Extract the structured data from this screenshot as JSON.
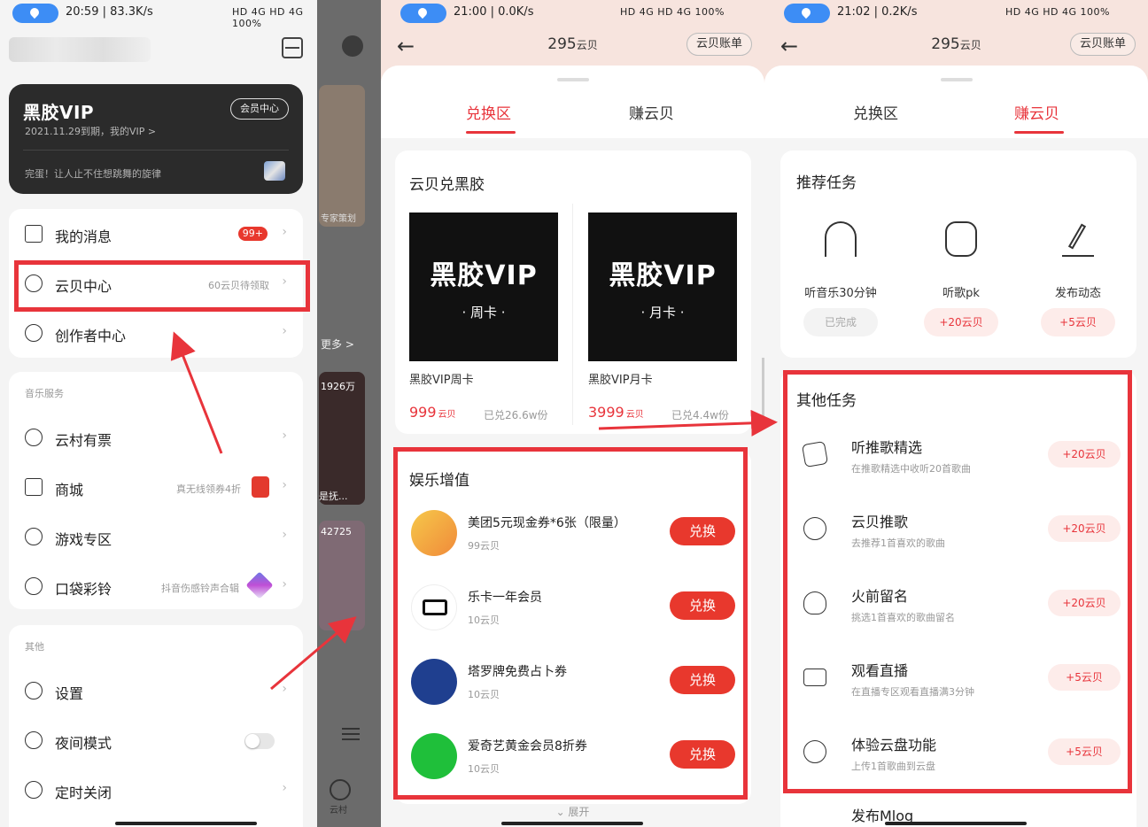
{
  "panel1": {
    "status": {
      "time": "20:59 | 83.3K/s",
      "right": "HD 4G HD 4G 100%"
    },
    "vip_card": {
      "logo": "黑胶VIP",
      "expiry": "2021.11.29到期，我的VIP >",
      "center_button": "会员中心",
      "slogan": "完蛋！让人止不住想跳舞的旋律"
    },
    "menu_main": [
      {
        "label": "我的消息",
        "badge": "99+",
        "sub": ""
      },
      {
        "label": "云贝中心",
        "badge": "",
        "sub": "60云贝待领取"
      },
      {
        "label": "创作者中心",
        "badge": "",
        "sub": ""
      }
    ],
    "music_services": {
      "header": "音乐服务",
      "items": [
        {
          "label": "云村有票",
          "sub": ""
        },
        {
          "label": "商城",
          "sub": "真无线领券4折"
        },
        {
          "label": "游戏专区",
          "sub": ""
        },
        {
          "label": "口袋彩铃",
          "sub": "抖音伤感铃声合辑"
        }
      ]
    },
    "others": {
      "header": "其他",
      "items": [
        {
          "label": "设置"
        },
        {
          "label": "夜间模式"
        },
        {
          "label": "定时关闭"
        }
      ]
    },
    "overlay_texts": [
      "专家策划",
      "更多 >",
      "1926万",
      "是抚...",
      "42725",
      "云村"
    ]
  },
  "panel2": {
    "status": {
      "time": "21:00 | 0.0K/s",
      "right": "HD 4G HD 4G 100%"
    },
    "balance": "295",
    "balance_unit": "云贝",
    "ledger_button": "云贝账单",
    "tabs": [
      "兑换区",
      "赚云贝"
    ],
    "active_tab": 0,
    "vinyl_section": {
      "title": "云贝兑黑胶",
      "products": [
        {
          "tile_logo": "黑胶VIP",
          "tile_sub": "· 周卡 ·",
          "name": "黑胶VIP周卡",
          "price": "999",
          "unit": "云贝",
          "sold": "已兑26.6w份"
        },
        {
          "tile_logo": "黑胶VIP",
          "tile_sub": "· 月卡 ·",
          "name": "黑胶VIP月卡",
          "price": "3999",
          "unit": "云贝",
          "sold": "已兑4.4w份"
        }
      ]
    },
    "entertainment": {
      "title": "娱乐增值",
      "items": [
        {
          "title": "美团5元现金券*6张（限量）",
          "cost": "99云贝",
          "button": "兑换"
        },
        {
          "title": "乐卡一年会员",
          "cost": "10云贝",
          "button": "兑换"
        },
        {
          "title": "塔罗牌免费占卜券",
          "cost": "10云贝",
          "button": "兑换"
        },
        {
          "title": "爱奇艺黄金会员8折券",
          "cost": "10云贝",
          "button": "兑换"
        }
      ]
    },
    "expand": "⌄ 展开"
  },
  "panel3": {
    "status": {
      "time": "21:02 | 0.2K/s",
      "right": "HD 4G HD 4G 100%"
    },
    "balance": "295",
    "balance_unit": "云贝",
    "ledger_button": "云贝账单",
    "tabs": [
      "兑换区",
      "赚云贝"
    ],
    "active_tab": 1,
    "recommended": {
      "title": "推荐任务",
      "items": [
        {
          "label": "听音乐30分钟",
          "pill": "已完成",
          "state": "done",
          "icon": "headphones-icon"
        },
        {
          "label": "听歌pk",
          "pill": "+20云贝",
          "state": "reward",
          "icon": "headset-icon"
        },
        {
          "label": "发布动态",
          "pill": "+5云贝",
          "state": "reward",
          "icon": "pen-icon"
        }
      ]
    },
    "other_tasks": {
      "title": "其他任务",
      "items": [
        {
          "title": "听推歌精选",
          "sub": "在推歌精选中收听20首歌曲",
          "pill": "+20云贝",
          "icon": "music-card-icon"
        },
        {
          "title": "云贝推歌",
          "sub": "去推荐1首喜欢的歌曲",
          "pill": "+20云贝",
          "icon": "coin-icon"
        },
        {
          "title": "火前留名",
          "sub": "挑选1首喜欢的歌曲留名",
          "pill": "+20云贝",
          "icon": "flame-icon"
        },
        {
          "title": "观看直播",
          "sub": "在直播专区观看直播满3分钟",
          "pill": "+5云贝",
          "icon": "live-camera-icon"
        },
        {
          "title": "体验云盘功能",
          "sub": "上传1首歌曲到云盘",
          "pill": "+5云贝",
          "icon": "cloud-upload-icon"
        }
      ],
      "partial_next": "发布Mlog"
    }
  },
  "colors": {
    "accent": "#e8343b",
    "header_bg": "#f7e4de",
    "vip_card": "#2b2b2b",
    "location_pill": "#3d8df5"
  }
}
